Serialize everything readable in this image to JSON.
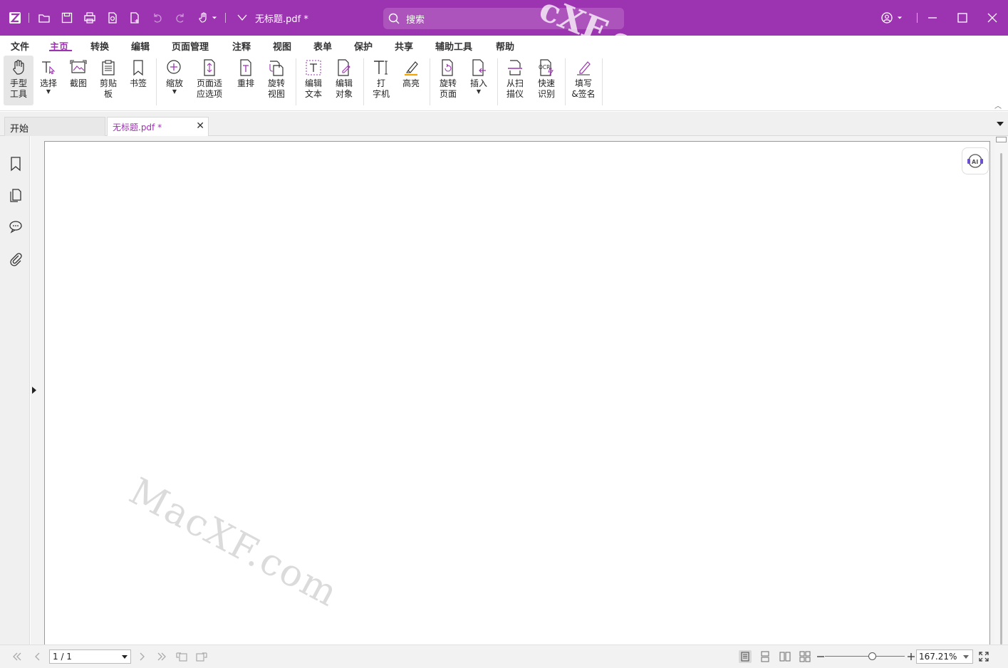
{
  "app": {
    "doc_title": "无标题.pdf *",
    "brand_color": "#9c33b0"
  },
  "search": {
    "placeholder": "搜索"
  },
  "menu": {
    "items": [
      "文件",
      "主页",
      "转换",
      "编辑",
      "页面管理",
      "注释",
      "视图",
      "表单",
      "保护",
      "共享",
      "辅助工具",
      "帮助"
    ],
    "active": "主页"
  },
  "ribbon": {
    "hand_tool": "手型\n工具",
    "select": "选择",
    "screenshot": "截图",
    "clipboard": "剪贴\n板",
    "bookmark": "书签",
    "zoom": "缩放",
    "page_fit": "页面适\n应选项",
    "reflow": "重排",
    "rotate_view": "旋转\n视图",
    "edit_text": "编辑\n文本",
    "edit_object": "编辑\n对象",
    "typewriter": "打\n字机",
    "highlight": "高亮",
    "rotate_page": "旋转\n页面",
    "insert": "插入",
    "from_scanner": "从扫\n描仪",
    "quick_ocr": "快速\n识别",
    "fill_sign": "填写\n&签名",
    "ocr_badge": "OCR"
  },
  "tabs": {
    "start": "开始",
    "doc": "无标题.pdf *",
    "close_glyph": "✕"
  },
  "ai_badge": "AI",
  "status": {
    "page": "1 / 1",
    "zoom": "167.21%"
  },
  "watermark": "MacXF.com",
  "watermark_top": "cXF.com"
}
